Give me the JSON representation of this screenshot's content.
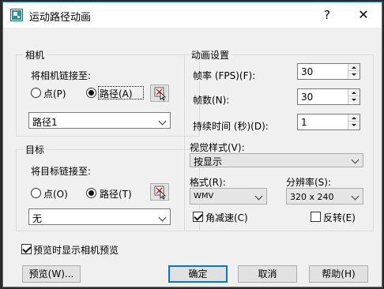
{
  "window": {
    "title": "运动路径动画",
    "help_glyph": "?",
    "close_glyph": "✕"
  },
  "camera": {
    "group_label": "相机",
    "link_label": "将相机链接至:",
    "point_label": "点(P)",
    "path_label": "路径(A)",
    "selected": "path",
    "path_value": "路径1"
  },
  "target": {
    "group_label": "目标",
    "link_label": "将目标链接至:",
    "point_label": "点(O)",
    "path_label": "路径(T)",
    "selected": "path",
    "path_value": "无"
  },
  "animation": {
    "group_label": "动画设置",
    "fps_label": "帧率 (FPS)(F):",
    "fps_value": "30",
    "frames_label": "帧数(N):",
    "frames_value": "30",
    "duration_label": "持续时间 (秒)(D):",
    "duration_value": "1",
    "visual_style_label": "视觉样式(V):",
    "visual_style_value": "按显示",
    "format_label": "格式(R):",
    "format_value": "WMV",
    "resolution_label": "分辨率(S):",
    "resolution_value": "320 x 240",
    "corner_decel_label": "角减速(C)",
    "corner_decel_checked": true,
    "reverse_label": "反转(E)",
    "reverse_checked": false
  },
  "preview_camera_label": "预览时显示相机预览",
  "preview_camera_checked": true,
  "buttons": {
    "preview": "预览(W)...",
    "ok": "确定",
    "cancel": "取消",
    "help": "帮助(H)"
  }
}
